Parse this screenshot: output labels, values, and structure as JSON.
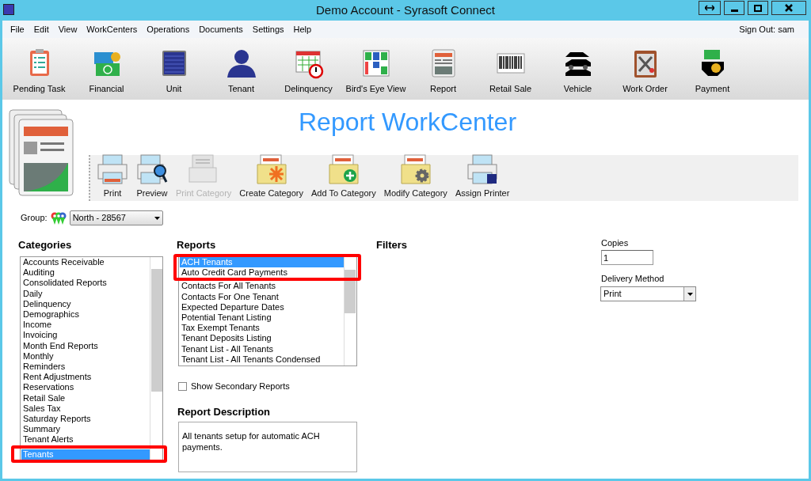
{
  "window": {
    "title": "Demo Account - Syrasoft Connect"
  },
  "menu": [
    "File",
    "Edit",
    "View",
    "WorkCenters",
    "Operations",
    "Documents",
    "Settings",
    "Help"
  ],
  "sign_out": "Sign Out: sam",
  "toolbar": [
    "Pending Task",
    "Financial",
    "Unit",
    "Tenant",
    "Delinquency",
    "Bird's Eye View",
    "Report",
    "Retail Sale",
    "Vehicle",
    "Work Order",
    "Payment"
  ],
  "workcenter_title": "Report WorkCenter",
  "actions": [
    {
      "label": "Print",
      "disabled": false
    },
    {
      "label": "Preview",
      "disabled": false
    },
    {
      "label": "Print Category",
      "disabled": true
    },
    {
      "label": "Create Category",
      "disabled": false
    },
    {
      "label": "Add To Category",
      "disabled": false
    },
    {
      "label": "Modify Category",
      "disabled": false
    },
    {
      "label": "Assign Printer",
      "disabled": false
    }
  ],
  "group": {
    "label": "Group:",
    "value": "North - 28567"
  },
  "categories": {
    "title": "Categories",
    "items": [
      {
        "label": "Accounts Receivable",
        "selected": false
      },
      {
        "label": "Auditing",
        "selected": false
      },
      {
        "label": "Consolidated Reports",
        "selected": false
      },
      {
        "label": "Daily",
        "selected": false
      },
      {
        "label": "Delinquency",
        "selected": false
      },
      {
        "label": "Demographics",
        "selected": false
      },
      {
        "label": "Income",
        "selected": false
      },
      {
        "label": "Invoicing",
        "selected": false
      },
      {
        "label": "Month End Reports",
        "selected": false
      },
      {
        "label": "Monthly",
        "selected": false
      },
      {
        "label": "Reminders",
        "selected": false
      },
      {
        "label": "Rent Adjustments",
        "selected": false
      },
      {
        "label": "Reservations",
        "selected": false
      },
      {
        "label": "Retail Sale",
        "selected": false
      },
      {
        "label": "Sales Tax",
        "selected": false
      },
      {
        "label": "Saturday Reports",
        "selected": false
      },
      {
        "label": "Summary",
        "selected": false
      },
      {
        "label": "Tenant Alerts",
        "selected": false
      },
      {
        "label": "Tenants",
        "selected": true
      }
    ]
  },
  "reports": {
    "title": "Reports",
    "items": [
      {
        "label": "ACH Tenants",
        "selected": true
      },
      {
        "label": "Auto Credit Card Payments",
        "selected": false
      },
      {
        "label": "Contacts For All Tenants",
        "selected": false
      },
      {
        "label": "Contacts For One Tenant",
        "selected": false
      },
      {
        "label": "Expected Departure Dates",
        "selected": false
      },
      {
        "label": "Potential Tenant Listing",
        "selected": false
      },
      {
        "label": "Tax Exempt Tenants",
        "selected": false
      },
      {
        "label": "Tenant Deposits Listing",
        "selected": false
      },
      {
        "label": "Tenant List - All Tenants",
        "selected": false
      },
      {
        "label": "Tenant List - All Tenants Condensed",
        "selected": false
      }
    ]
  },
  "show_secondary": {
    "label": "Show Secondary Reports",
    "checked": false
  },
  "description": {
    "title": "Report Description",
    "text": "All tenants setup for automatic ACH payments."
  },
  "filters": {
    "title": "Filters"
  },
  "copies": {
    "label": "Copies",
    "value": "1"
  },
  "delivery": {
    "label": "Delivery Method",
    "value": "Print"
  }
}
